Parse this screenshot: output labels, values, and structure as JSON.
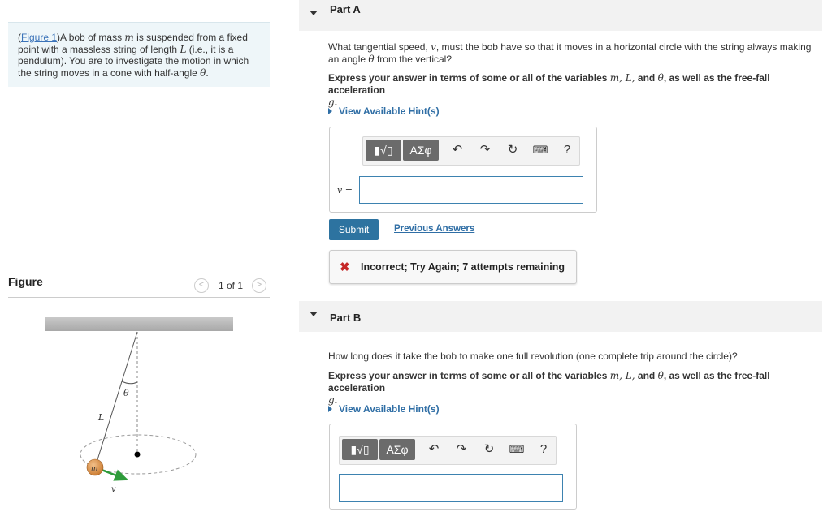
{
  "intro": {
    "figure_link": "Figure 1",
    "text_a": "A bob of mass ",
    "var_m": "m",
    "text_b": " is suspended from a fixed point with a massless string of length ",
    "var_L": "L",
    "text_c": " (i.e., it is a pendulum). You are to investigate the motion in which the string moves in a cone with half-angle ",
    "var_theta": "θ",
    "text_d": "."
  },
  "figure_panel": {
    "label": "Figure",
    "prev": "<",
    "next": ">",
    "count": "1 of 1",
    "labels": {
      "theta": "θ",
      "length": "L",
      "mass": "m",
      "velocity": "v"
    }
  },
  "part_a": {
    "title": "Part A",
    "question_1": "What tangential speed, ",
    "question_var": "v",
    "question_2": ", must the bob have so that it moves in a horizontal circle with the string always making an angle ",
    "question_theta": "θ",
    "question_3": " from the vertical?",
    "instruction_1": "Express your answer in terms of some or all of the variables ",
    "instruction_vars": "m, L,",
    "instruction_2": " and ",
    "instruction_theta": "θ",
    "instruction_3": ", as well as the free-fall acceleration",
    "instruction_g": "g",
    "instruction_end": ".",
    "hint": "View Available Hint(s)",
    "toolbar": {
      "templates": "▮√▯",
      "symbols": "ΑΣφ",
      "help": "?"
    },
    "answer_label": "v =",
    "answer_value": "",
    "submit": "Submit",
    "previous_answers": "Previous Answers",
    "feedback_icon": "✖",
    "feedback": "Incorrect; Try Again; 7 attempts remaining"
  },
  "part_b": {
    "title": "Part B",
    "question": "How long does it take the bob to make one full revolution (one complete trip around the circle)?",
    "instruction_1": "Express your answer in terms of some or all of the variables ",
    "instruction_vars": "m, L,",
    "instruction_2": " and ",
    "instruction_theta": "θ",
    "instruction_3": ", as well as the free-fall acceleration",
    "instruction_g": "g",
    "instruction_end": ".",
    "hint": "View Available Hint(s)",
    "toolbar": {
      "templates": "▮√▯",
      "symbols": "ΑΣφ",
      "help": "?"
    },
    "answer_value": ""
  },
  "colors": {
    "link": "#2f6ea5",
    "submit": "#2d73a0",
    "error": "#c62828",
    "intro_bg": "#eef6f9"
  }
}
